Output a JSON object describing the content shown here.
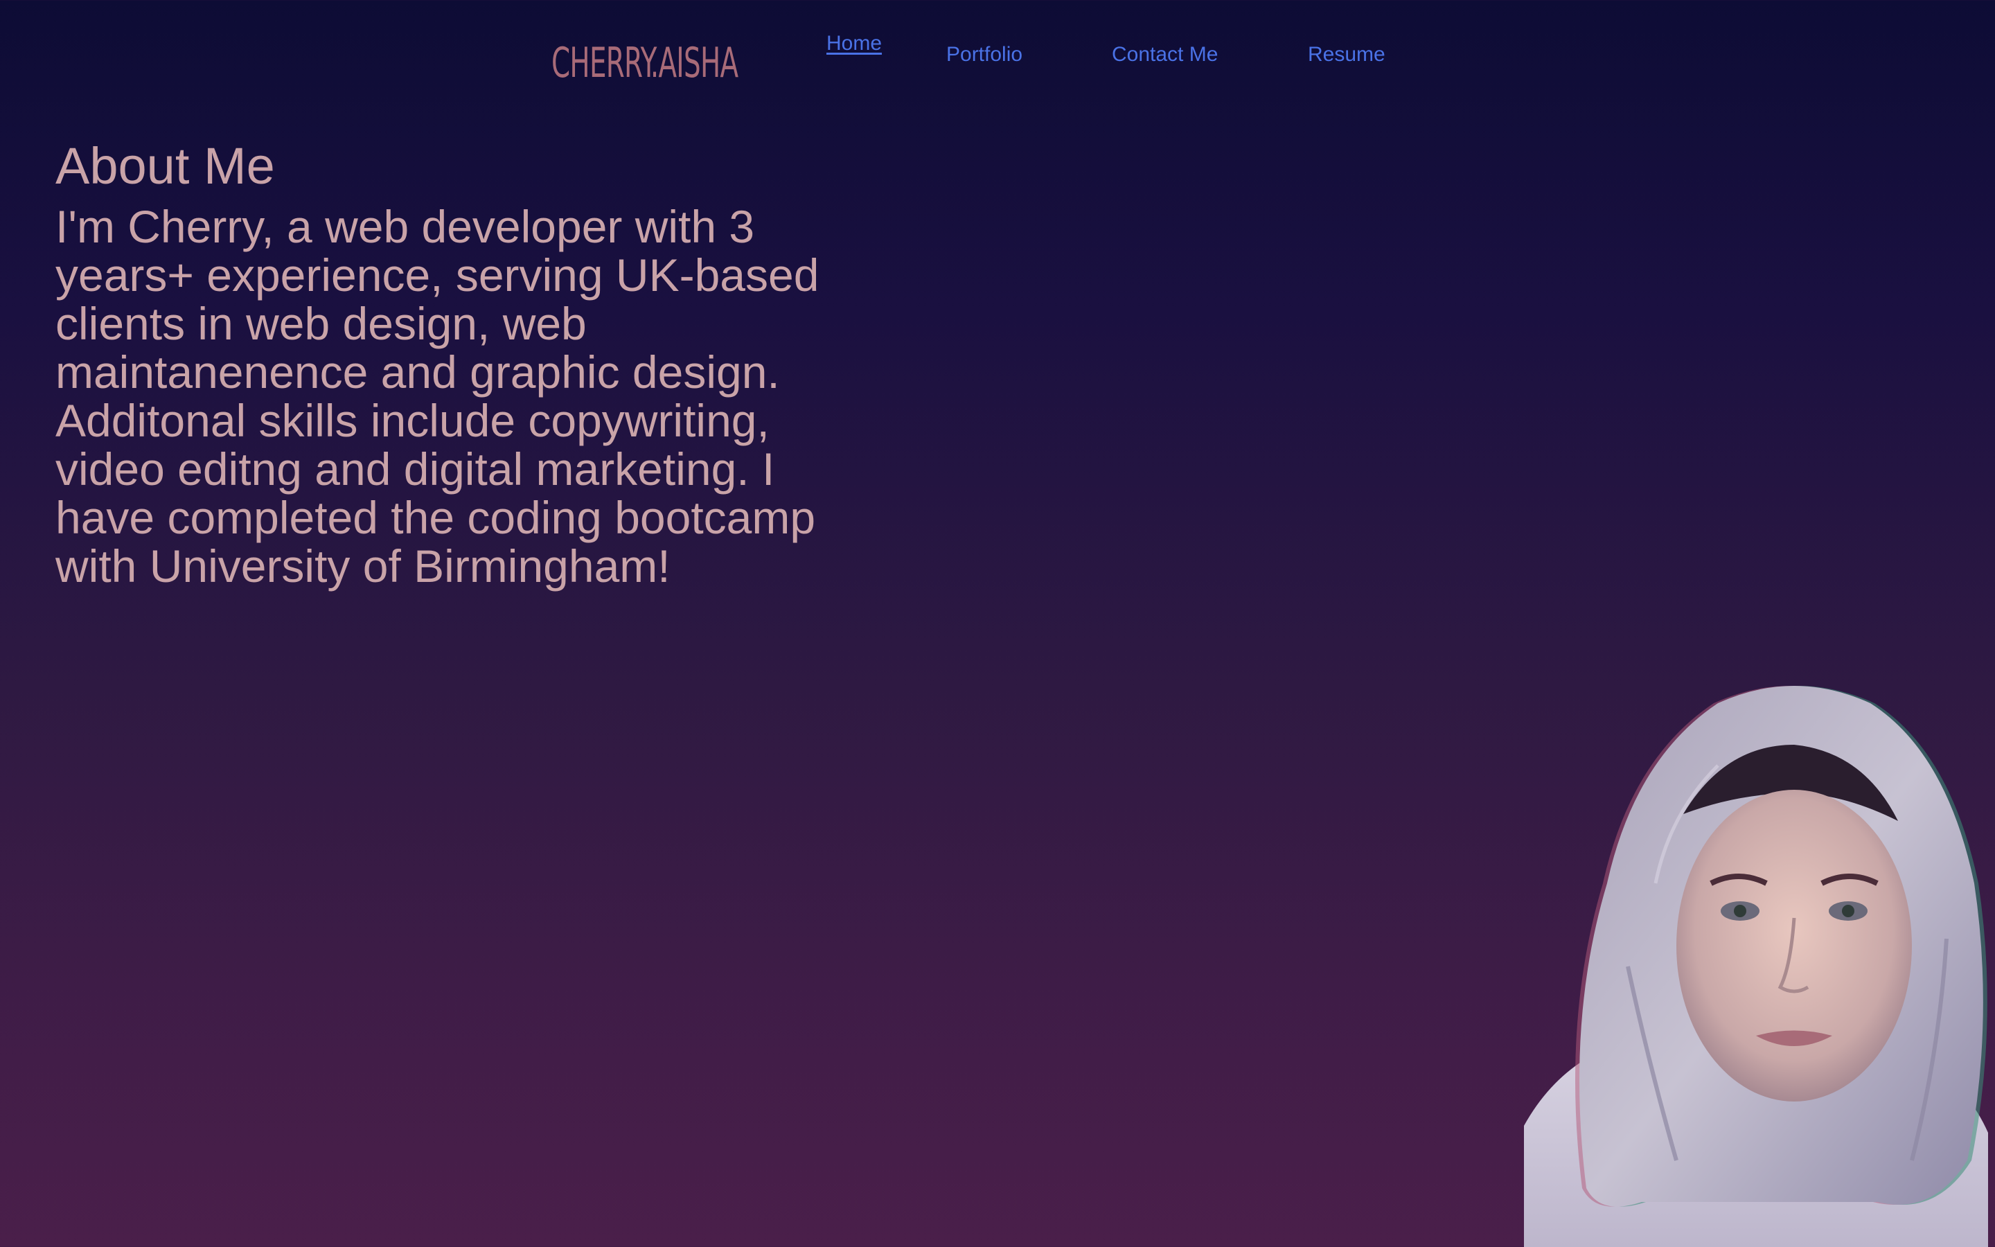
{
  "nav": {
    "logo": "CHERRY.AISHA",
    "links": [
      {
        "label": "Home",
        "active": true
      },
      {
        "label": "Portfolio",
        "active": false
      },
      {
        "label": "Contact Me",
        "active": false
      },
      {
        "label": "Resume",
        "active": false
      }
    ],
    "link_color": "#4a72e6",
    "logo_color": "#a86b78"
  },
  "about": {
    "heading": "About Me",
    "body": "I'm Cherry, a web developer with 3 years+ experience, serving UK-based clients in web design, web maintanenence and graphic design. Additonal skills include copywriting, video editng and digital marketing. I have completed the coding bootcamp with University of Birmingham!",
    "text_color": "#c9a3a8"
  },
  "portrait": {
    "icon": "profile-photo"
  }
}
